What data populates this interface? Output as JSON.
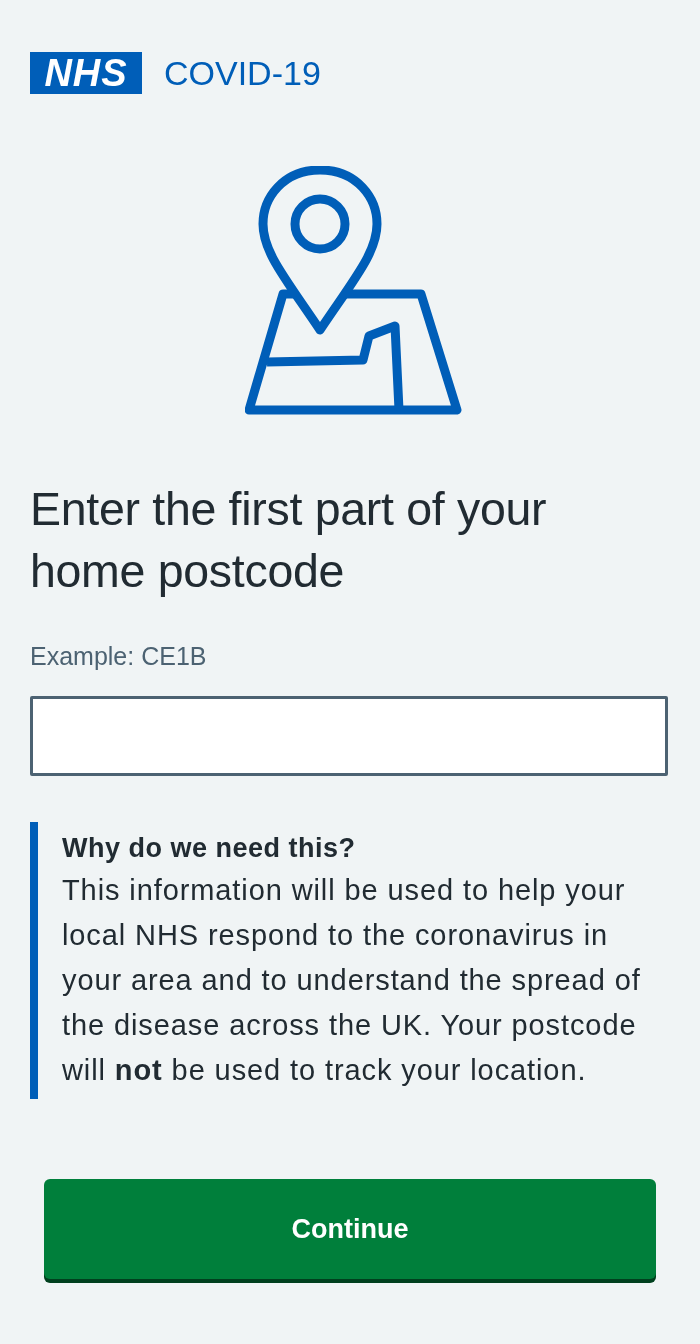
{
  "header": {
    "logo": "NHS",
    "title": "COVID-19"
  },
  "heading": "Enter the first part of your home postcode",
  "postcode_field": {
    "label": "Example: CE1B"
  },
  "info": {
    "title": "Why do we need this?",
    "body": "This information will be used to help your local NHS respond to the coronavirus in your area and to understand the spread of the disease across the UK. Your postcode will **not** be used to track your location."
  },
  "button": {
    "label": "Continue"
  }
}
